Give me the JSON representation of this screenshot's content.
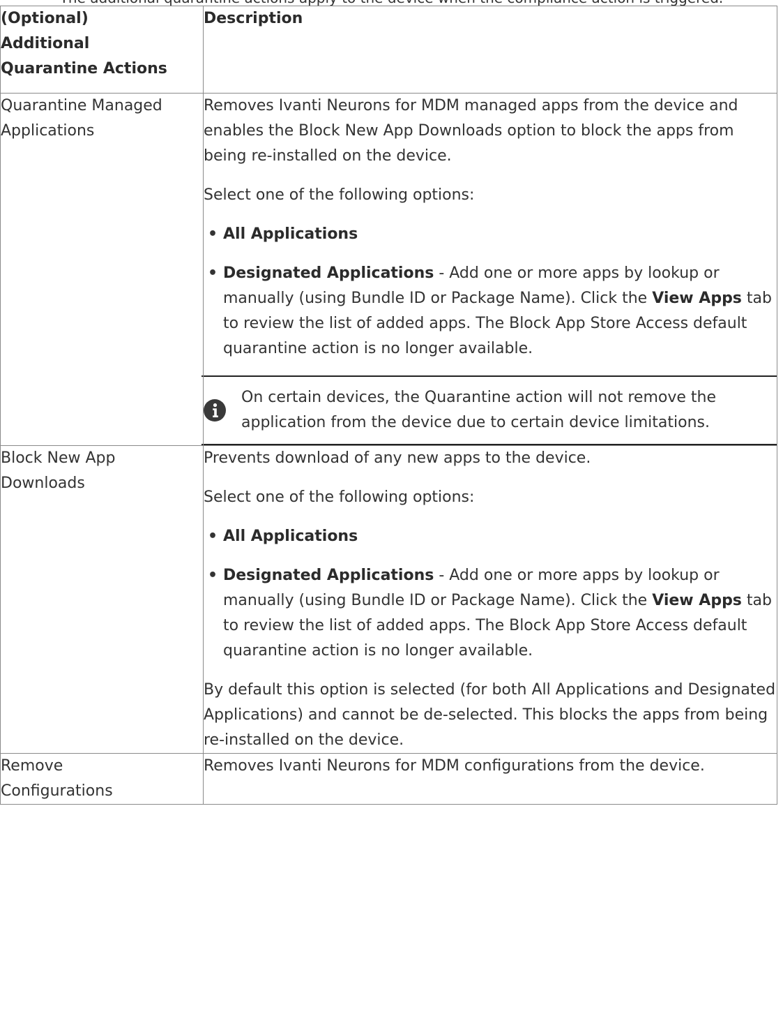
{
  "top_caption": "The additional quarantine actions apply to the device when the compliance action is triggered.",
  "table": {
    "header": {
      "col1": "(Optional) Additional Quarantine Actions",
      "col1_lines": [
        "(Optional)",
        "Additional",
        "Quarantine Actions"
      ],
      "col2": "Description"
    },
    "rows": [
      {
        "name": "Quarantine Managed Applications",
        "intro": "Removes Ivanti Neurons for MDM managed apps from the device and enables the Block New App Downloads option to block the apps from being re-installed on the device.",
        "select_text": "Select one of the following options:",
        "option_all": "All Applications",
        "option_designated": "Designated Applications",
        "designated_text_1": " - Add one or more apps by lookup or manually (using Bundle ID or Package Name). Click the ",
        "designated_view_apps": "View Apps",
        "designated_text_2": " tab to review the list of added apps. The Block App Store Access default quarantine action is no longer available.",
        "note_text": "On certain devices, the Quarantine action will not remove the application from the device due to certain device limitations.",
        "note_icon": "info-icon"
      },
      {
        "name": "Block New App Downloads",
        "intro": "Prevents download of any new apps to the device.",
        "select_text": "Select one of the following options:",
        "option_all": "All Applications",
        "option_designated": "Designated Applications",
        "designated_text_1": " - Add one or more apps by lookup or manually (using Bundle ID or Package Name). Click the ",
        "designated_view_apps": "View Apps",
        "designated_text_2": " tab to review the list of added apps. The Block App Store Access default quarantine action is no longer available.",
        "outro": "By default this option is selected (for both All Applications and Designated Applications) and cannot be de-selected. This blocks the apps from being re-installed on the device."
      },
      {
        "name": "Remove Configurations",
        "intro": "Removes Ivanti Neurons for MDM configurations from the device."
      }
    ]
  },
  "colors": {
    "border": "#8a8a8a",
    "text": "#333333",
    "note_rule": "#222222",
    "icon_fill": "#3a3a3a"
  }
}
